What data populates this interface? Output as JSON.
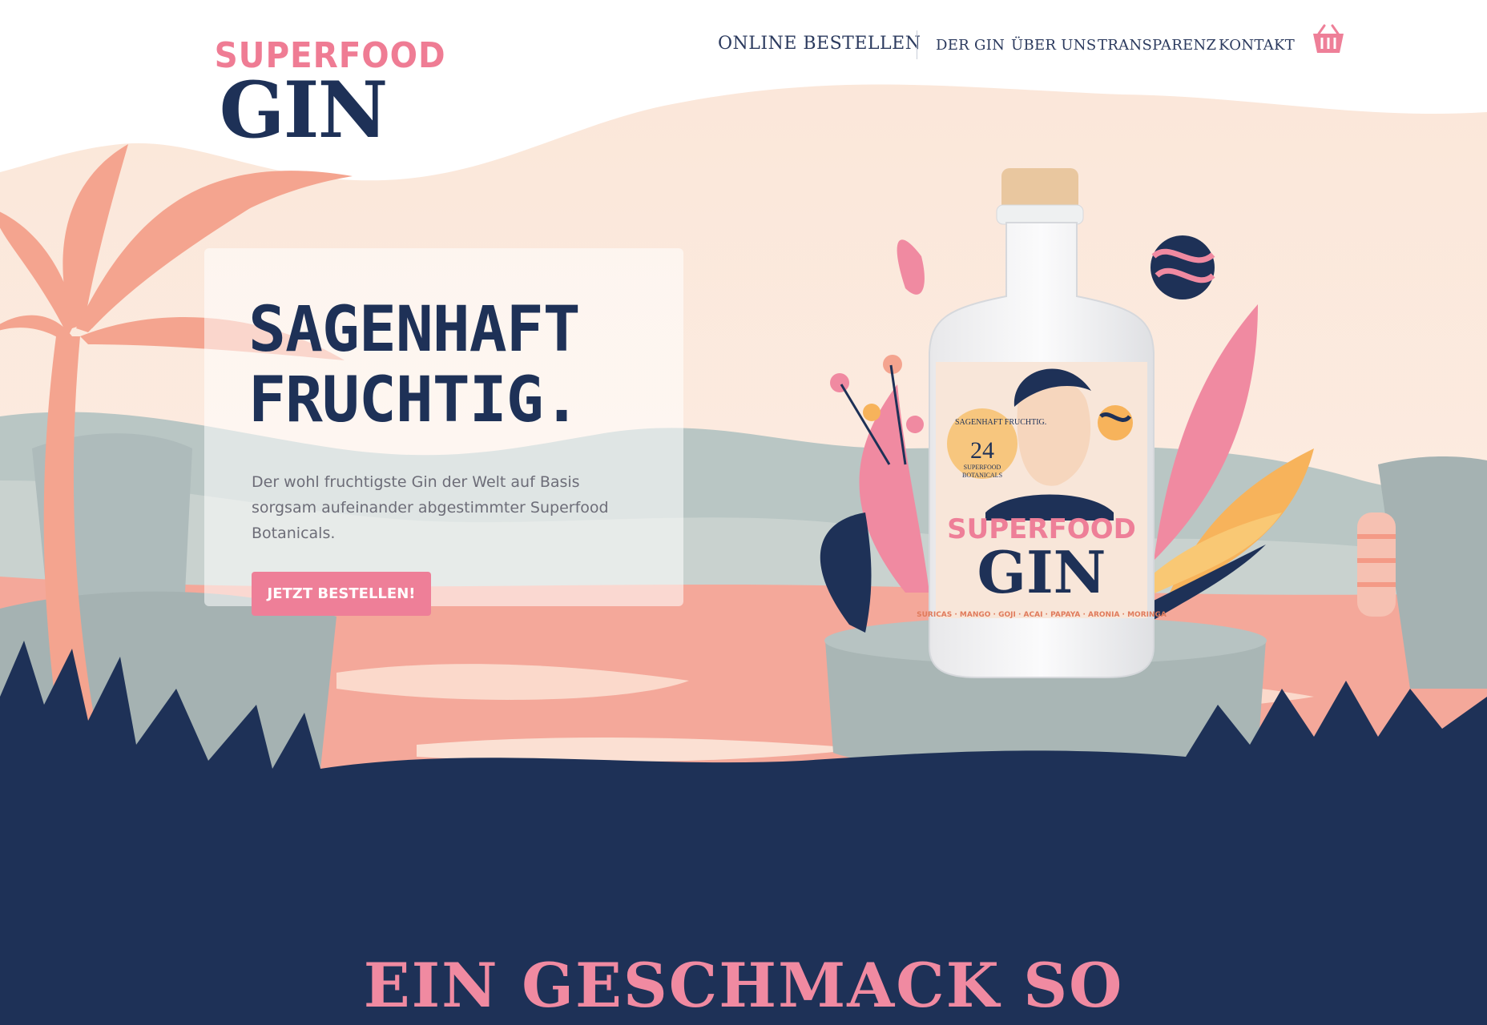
{
  "logo": {
    "top": "SUPERFOOD",
    "main": "GIN"
  },
  "nav": {
    "order_label": "ONLINE BESTELLEN",
    "items": [
      "DER GIN",
      "ÜBER UNS",
      "TRANSPARENZ",
      "KONTAKT"
    ],
    "cart_icon": "basket-icon"
  },
  "hero": {
    "title_line1": "SAGENHAFT",
    "title_line2": "FRUCHTIG.",
    "text": "Der wohl fruchtigste Gin der Welt auf Basis sorgsam aufeinander abgestimmter Superfood Botanicals.",
    "cta_label": "JETZT BESTELLEN!"
  },
  "bottle": {
    "brand_top": "SUPERFOOD",
    "brand_main": "GIN",
    "badge_number": "24",
    "badge_line1": "SUPERFOOD",
    "badge_line2": "BOTANICALS",
    "badge_arc": "SAGENHAFT FRUCHTIG.",
    "ingredients": "SURICAS · MANGO · GOJI · ACAI · PAPAYA · ARONIA · MORINGA"
  },
  "section": {
    "heading": "EIN GESCHMACK SO"
  },
  "colors": {
    "navy": "#1e3157",
    "pink": "#ee7f98",
    "peach": "#fbe9dc",
    "sage": "#aebbbb"
  }
}
